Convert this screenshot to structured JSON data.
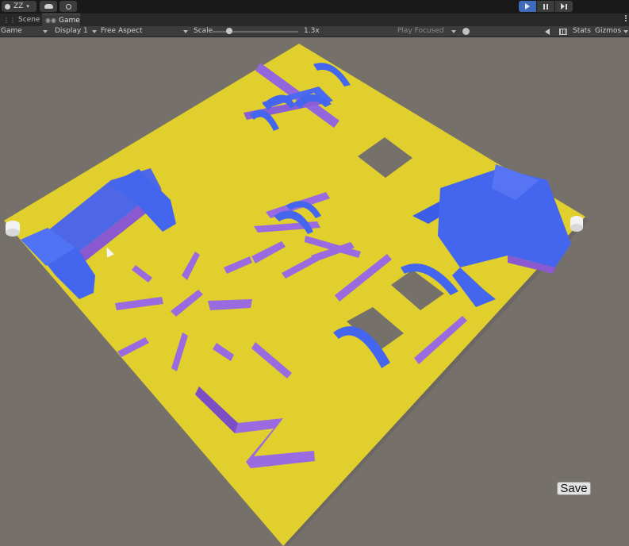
{
  "toolbar": {
    "account_label": "ZZ",
    "icons": [
      "account-icon",
      "cloud-icon",
      "collab-icon",
      "play-icon",
      "pause-icon",
      "step-icon"
    ],
    "play_state": "playing"
  },
  "tabs": [
    {
      "label": "Scene",
      "active": false,
      "icon": "scene-grid-icon"
    },
    {
      "label": "Game",
      "active": true,
      "icon": "gamepad-icon"
    }
  ],
  "game_toolbar": {
    "view_mode": "Game",
    "display": "Display 1",
    "aspect": "Free Aspect",
    "scale_label": "Scale",
    "scale_value": "1.3x",
    "play_mode": "Play Focused",
    "stats_label": "Stats",
    "gizmos_label": "Gizmos"
  },
  "viewport": {
    "save_label": "Save"
  },
  "colors": {
    "board": "#e0cf2d",
    "wall_purple": "#9a6ae0",
    "block_blue": "#4466ee",
    "background": "#76706b",
    "play_accent": "#3d6cbb"
  }
}
